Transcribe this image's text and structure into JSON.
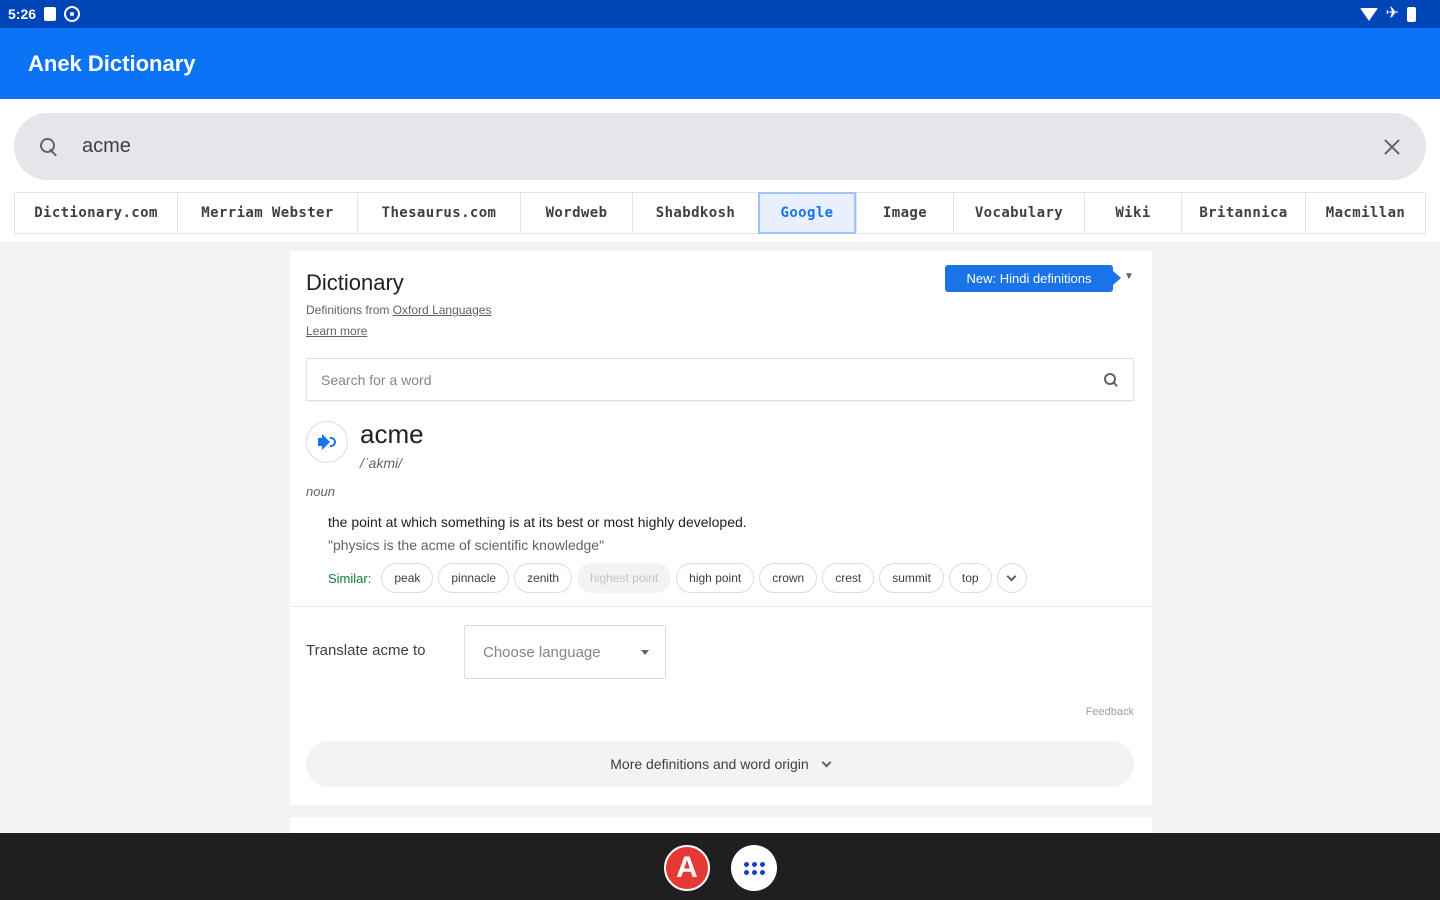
{
  "status_bar": {
    "time": "5:26"
  },
  "app": {
    "title": "Anek Dictionary"
  },
  "search": {
    "query": "acme"
  },
  "tabs": [
    {
      "label": "Dictionary.com"
    },
    {
      "label": "Merriam Webster"
    },
    {
      "label": "Thesaurus.com"
    },
    {
      "label": "Wordweb"
    },
    {
      "label": "Shabdkosh"
    },
    {
      "label": "Google",
      "active": true
    },
    {
      "label": "Image"
    },
    {
      "label": "Vocabulary"
    },
    {
      "label": "Wiki"
    },
    {
      "label": "Britannica"
    },
    {
      "label": "Macmillan"
    }
  ],
  "card": {
    "title": "Dictionary",
    "defs_prefix": "Definitions from",
    "defs_source": "Oxford Languages",
    "learn_more": "Learn more",
    "new_button": "New: Hindi definitions",
    "search_placeholder": "Search for a word",
    "headword": "acme",
    "phonetic": "/ˈakmi/",
    "part_of_speech": "noun",
    "definition": "the point at which something is at its best or most highly developed.",
    "example": "\"physics is the acme of scientific knowledge\"",
    "similar_label": "Similar:",
    "similar": [
      "peak",
      "pinnacle",
      "zenith",
      "highest point",
      "high point",
      "crown",
      "crest",
      "summit",
      "top"
    ],
    "translate_label": "Translate acme to",
    "language_placeholder": "Choose language",
    "feedback": "Feedback",
    "more_defs": "More definitions and word origin"
  },
  "nav": {
    "app_letter": "A"
  },
  "colors": {
    "status_bar": "#0045b8",
    "app_bar": "#0a73f6",
    "accent": "#1a73e8",
    "nav_app": "#e53935"
  }
}
